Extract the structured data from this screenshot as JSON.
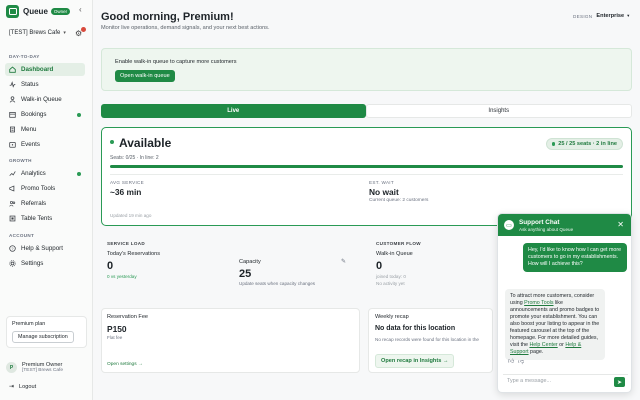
{
  "app": {
    "name": "Queue",
    "badge": "Owner"
  },
  "store": {
    "name": "[TEST] Brews Cafe"
  },
  "sidebar": {
    "sections": [
      {
        "title": "DAY-TO-DAY",
        "items": [
          {
            "label": "Dashboard",
            "icon": "home-icon"
          },
          {
            "label": "Status",
            "icon": "status-icon"
          },
          {
            "label": "Walk-in Queue",
            "icon": "walkin-icon"
          },
          {
            "label": "Bookings",
            "icon": "calendar-icon"
          },
          {
            "label": "Menu",
            "icon": "menu-icon"
          },
          {
            "label": "Events",
            "icon": "events-icon"
          }
        ]
      },
      {
        "title": "GROWTH",
        "items": [
          {
            "label": "Analytics",
            "icon": "analytics-icon"
          },
          {
            "label": "Promo Tools",
            "icon": "promo-icon"
          },
          {
            "label": "Referrals",
            "icon": "referrals-icon"
          },
          {
            "label": "Table Tents",
            "icon": "tabletent-icon"
          }
        ]
      },
      {
        "title": "ACCOUNT",
        "items": [
          {
            "label": "Help & Support",
            "icon": "help-icon"
          },
          {
            "label": "Settings",
            "icon": "settings-icon"
          }
        ]
      }
    ],
    "plan_label": "Premium plan",
    "plan_button": "Manage subscription",
    "profile_initial": "P",
    "profile_name": "Premium Owner",
    "profile_store": "[TEST] Brews Cafe",
    "logout": "Logout"
  },
  "header": {
    "greeting": "Good morning, Premium!",
    "subtitle": "Monitor live operations, demand signals, and your next best actions.",
    "design_label": "DESIGN",
    "design_value": "Enterprise"
  },
  "banner": {
    "text": "Enable walk-in queue to capture more customers",
    "button": "Open walk-in queue"
  },
  "tabs": [
    "Live",
    "Insights"
  ],
  "availability": {
    "title": "Available",
    "meta": "Seats: 0/25 · In line: 2",
    "badge": "25 / 25 seats · 2 in line",
    "progress": 1.0,
    "avg_service_label": "AVG SERVICE",
    "avg_service_value": "~36 min",
    "est_wait_label": "EST. WAIT",
    "est_wait_value": "No wait",
    "est_wait_sub": "Current queue: 2 customers",
    "updated": "Updated 19 min ago"
  },
  "service_load": {
    "label": "SERVICE LOAD",
    "reservations_label": "Today's Reservations",
    "reservations_value": "0",
    "reservations_sub": "0 vs yesterday",
    "capacity_label": "Capacity",
    "capacity_value": "25",
    "capacity_sub": "Update seats when capacity changes"
  },
  "customer_flow": {
    "label": "CUSTOMER FLOW",
    "walkin_label": "Walk-in Queue",
    "walkin_value": "0",
    "walkin_sub1": "joined today: 0",
    "walkin_sub2": "No activity yet"
  },
  "reservation_fee": {
    "title": "Reservation Fee",
    "value": "P150",
    "sub": "Flat fee",
    "link": "Open settings →"
  },
  "weekly_recap": {
    "label": "Weekly recap",
    "title": "No data for this location",
    "sub": "No recap records were found for this location in the",
    "button": "Open recap in Insights →"
  },
  "chat": {
    "title": "Support Chat",
    "subtitle": "Ask anything about Queue",
    "user_msg": "Hey, I'd like to know how I can get more customers to go in my establishments. How will I achieve this?",
    "bot_1": "To attract more customers, consider using ",
    "bot_link1": "Promo Tools",
    "bot_2": " like announcements and promo badges to promote your establishment. You can also boost your listing to appear in the featured carousel at the top of the homepage. For more detailed guides, visit the ",
    "bot_link2": "Help Center",
    "bot_3": " or ",
    "bot_link3": "Help & Support",
    "bot_4": " page.",
    "placeholder": "Type a message..."
  },
  "colors": {
    "brand": "#1f8a45",
    "active_bg": "#e4efe6",
    "accent_dot": "#2a9a55"
  }
}
